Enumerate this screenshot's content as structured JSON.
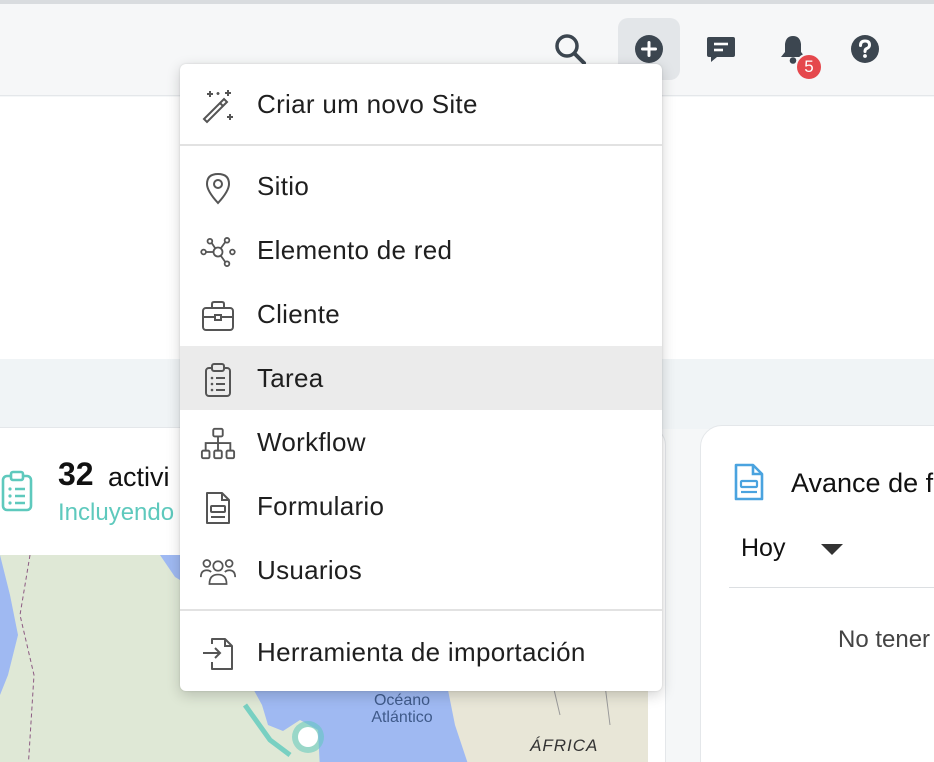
{
  "topbar": {
    "notifications_count": "5",
    "icons": [
      "search-icon",
      "plus-circle-icon",
      "message-icon",
      "bell-icon",
      "help-icon"
    ]
  },
  "menu": {
    "create_site": "Criar um novo Site",
    "items": [
      {
        "label": "Sitio",
        "icon": "map-pin-icon"
      },
      {
        "label": "Elemento de red",
        "icon": "network-icon"
      },
      {
        "label": "Cliente",
        "icon": "briefcase-icon"
      },
      {
        "label": "Tarea",
        "icon": "clipboard-list-icon"
      },
      {
        "label": "Workflow",
        "icon": "workflow-icon"
      },
      {
        "label": "Formulario",
        "icon": "form-icon"
      },
      {
        "label": "Usuarios",
        "icon": "users-icon"
      }
    ],
    "import_tool": "Herramienta de importación",
    "hovered_item": "Tarea"
  },
  "activities_card": {
    "count": "32",
    "count_label": "activi",
    "subtitle": "Incluyendo",
    "map_labels": {
      "ocean": "Océano\nAtlántico",
      "continent": "ÁFRICA"
    }
  },
  "progress_card": {
    "title": "Avance de f",
    "period": "Hoy",
    "empty_text": "No tener"
  },
  "colors": {
    "accent_teal": "#5ec9bd",
    "icon_blue": "#4aa3df",
    "badge_red": "#e5484d",
    "icon_dark": "#3c4650"
  }
}
